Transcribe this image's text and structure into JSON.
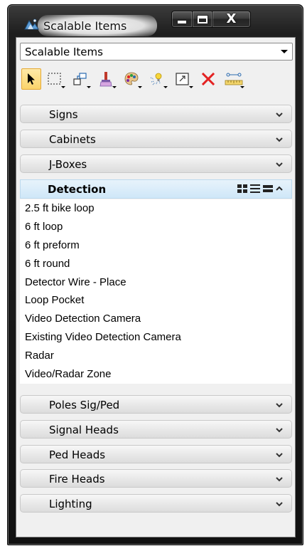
{
  "window": {
    "title": "Scalable Items",
    "close_label": "X"
  },
  "combo": {
    "value": "Scalable Items"
  },
  "toolbar": {
    "tools": [
      "select-arrow-icon",
      "select-marquee-icon",
      "place-element-icon",
      "paint-brush-icon",
      "color-palette-icon",
      "light-bulb-icon",
      "scale-icon",
      "delete-x-icon",
      "measure-ruler-icon"
    ]
  },
  "sections_above": [
    {
      "label": "Signs"
    },
    {
      "label": "Cabinets"
    },
    {
      "label": "J-Boxes"
    }
  ],
  "expanded_section": {
    "label": "Detection",
    "items": [
      "2.5 ft bike loop",
      "6 ft loop",
      "6 ft preform",
      "6 ft round",
      "Detector Wire - Place",
      "Loop Pocket",
      "Video Detection Camera",
      "Existing Video Detection Camera",
      "Radar",
      "Video/Radar Zone"
    ]
  },
  "sections_below": [
    {
      "label": "Poles Sig/Ped"
    },
    {
      "label": "Signal Heads"
    },
    {
      "label": "Ped Heads"
    },
    {
      "label": "Fire Heads"
    },
    {
      "label": "Lighting"
    }
  ],
  "colors": {
    "accent_blue": "#cfe7f8",
    "delete_red": "#e32222",
    "selected_tool": "#fbd46b"
  }
}
